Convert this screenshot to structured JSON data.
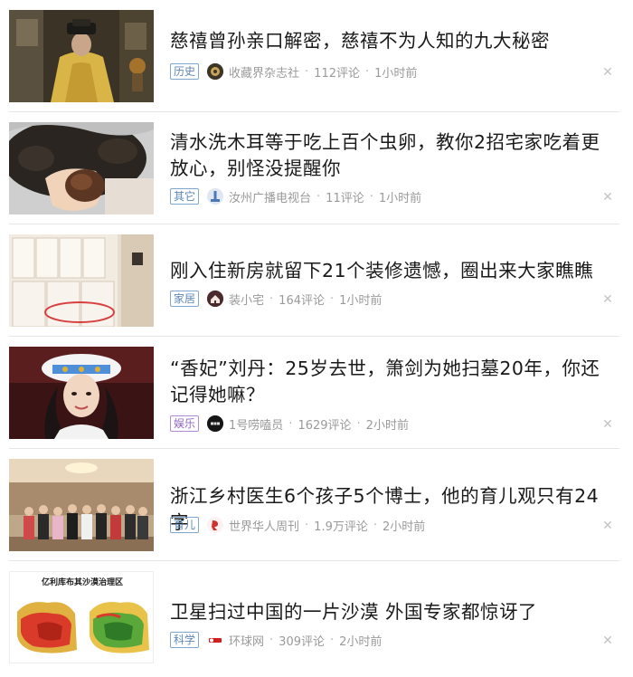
{
  "feed": {
    "items": [
      {
        "title": "慈禧曾孙亲口解密，慈禧不为人知的九大秘密",
        "tag": "历史",
        "source": "收藏界杂志社",
        "comments": "112评论",
        "time": "1小时前",
        "thumb_icon": "empress-portrait-photo",
        "source_icon": "magazine-avatar-icon"
      },
      {
        "title": "清水洗木耳等于吃上百个虫卵，教你2招宅家吃着更放心，别怪没提醒你",
        "tag": "其它",
        "source": "汝州广播电视台",
        "comments": "11评论",
        "time": "1小时前",
        "thumb_icon": "wood-ear-mushroom-photo",
        "source_icon": "tv-station-avatar-icon"
      },
      {
        "title": "刚入住新房就留下21个装修遗憾，圈出来大家瞧瞧",
        "tag": "家居",
        "source": "装小宅",
        "comments": "164评论",
        "time": "1小时前",
        "thumb_icon": "cabinet-room-photo",
        "source_icon": "house-avatar-icon"
      },
      {
        "title": "“香妃”刘丹：25岁去世，箫剑为她扫墓20年，你还记得她嘛？",
        "tag": "娱乐",
        "source": "1号唠嗑员",
        "comments": "1629评论",
        "time": "2小时前",
        "thumb_icon": "actress-costume-photo",
        "source_icon": "chat-avatar-icon"
      },
      {
        "title": "浙江乡村医生6个孩子5个博士，他的育儿观只有24字",
        "tag": "育儿",
        "source": "世界华人周刊",
        "comments": "1.9万评论",
        "time": "2小时前",
        "thumb_icon": "family-group-photo",
        "source_icon": "weekly-avatar-icon"
      },
      {
        "title": "卫星扫过中国的一片沙漠 外国专家都惊讶了",
        "tag": "科学",
        "source": "环球网",
        "comments": "309评论",
        "time": "2小时前",
        "thumb_icon": "desert-map-image",
        "thumb_text": "亿利库布其沙漠治理区",
        "source_icon": "huanqiu-avatar-icon"
      }
    ],
    "close_icon": "close-icon",
    "colors": {
      "tag_blue": "#5f87b6",
      "tag_purple": "#9265c7",
      "divider": "#e6e6e6",
      "meta_text": "#9a9a9a"
    }
  }
}
